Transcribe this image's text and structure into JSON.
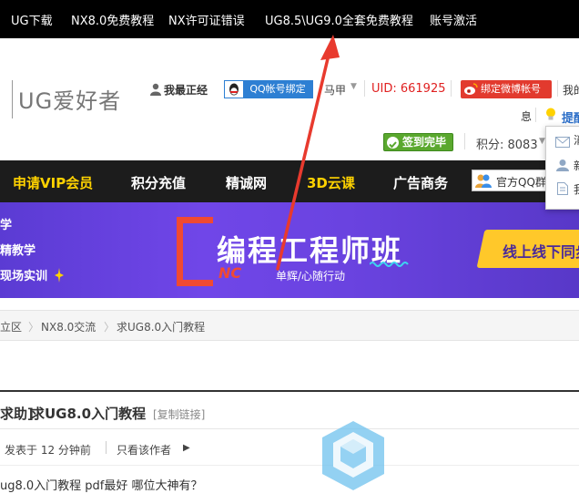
{
  "top_nav": [
    "UG下载",
    "NX8.0免费教程",
    "NX许可证错误",
    "UG8.5\\UG9.0全套免费教程",
    "账号激活"
  ],
  "logo": "UG爱好者",
  "user": {
    "realname_label": "我最正经",
    "qq_bind": "QQ帐号绑定",
    "username": "马甲",
    "uid": "UID: 661925",
    "weibo_bind": "绑定微博帐号",
    "my_partial": "我的",
    "msg_partial": "息",
    "tip_partial": "提醒",
    "signed": "签到完毕",
    "points": "积分: 8083"
  },
  "main_nav": [
    "申请VIP会员",
    "积分充值",
    "精诚网",
    "3D云课",
    "广告商务"
  ],
  "qq_group_partial": "官方QQ群",
  "banner": {
    "left_lines": [
      "学",
      "精教学",
      "现场实训"
    ],
    "title": "编程工程师班",
    "nc": "NC",
    "subtitle": "单辉/心随行动",
    "cta": "线上线下同步"
  },
  "dropdown": [
    "消",
    "新",
    "我"
  ],
  "breadcrumb": [
    "立区",
    "NX8.0交流",
    "求UG8.0入门教程"
  ],
  "thread": {
    "prefix": "求助]",
    "title": "求UG8.0入门教程",
    "copy_link": "[复制链接]",
    "posted": "发表于 12 分钟前",
    "only_author": "只看该作者",
    "body": "ug8.0入门教程 pdf最好  哪位大神有？"
  },
  "colors": {
    "accent_red": "#e83a2e",
    "nav_yellow": "#ffd200",
    "uid_red": "#e02020",
    "banner_purple": "#6a43e0"
  }
}
